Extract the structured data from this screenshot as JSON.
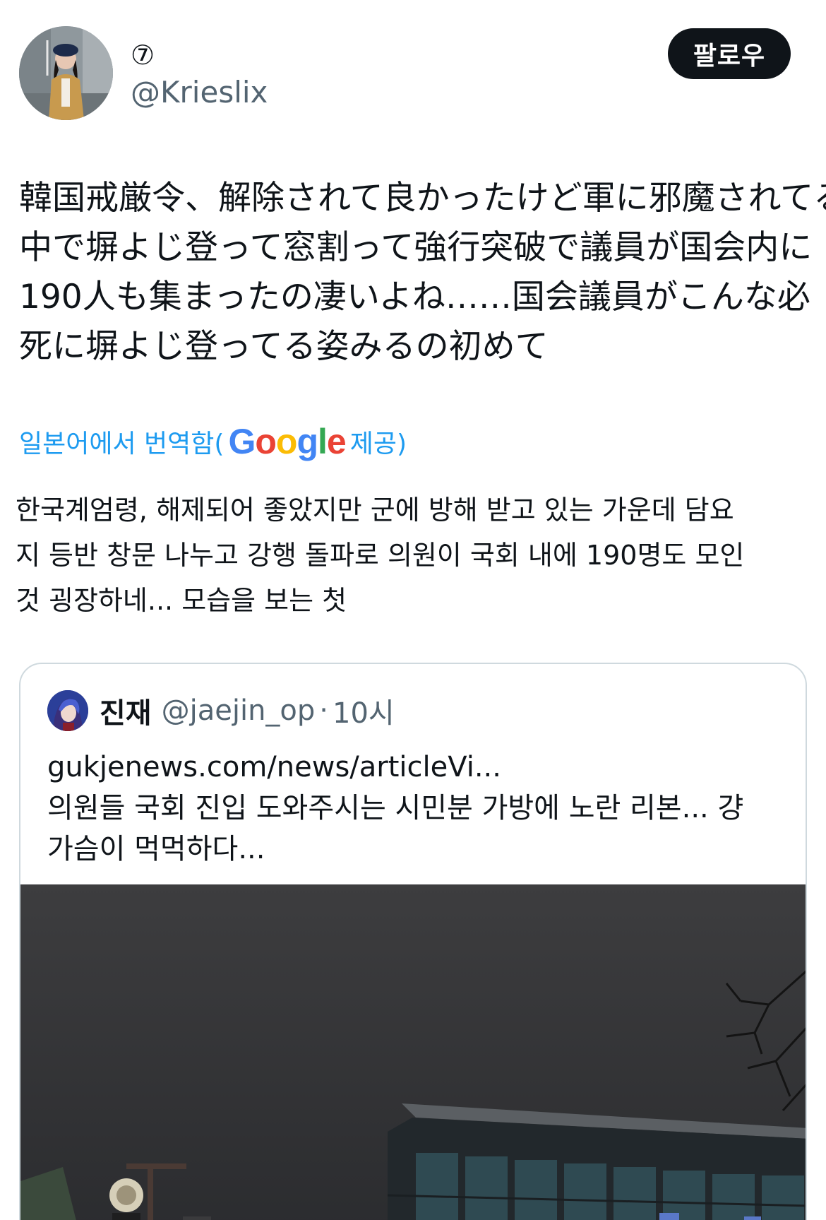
{
  "author": {
    "display_name": "⑦",
    "handle": "@Krieslix"
  },
  "follow_button_label": "팔로우",
  "tweet": {
    "lines": [
      "韓国戒厳令、解除されて良かったけど軍に邪魔されてる",
      "中で塀よじ登って窓割って強行突破で議員が国会内に",
      "190人も集まったの凄いよね……国会議員がこんな必",
      "死に塀よじ登ってる姿みるの初めて"
    ]
  },
  "translation": {
    "prefix": "일본어에서 번역함(",
    "google_letters": [
      "G",
      "o",
      "o",
      "g",
      "l",
      "e"
    ],
    "suffix": " 제공)",
    "lines": [
      "한국계엄령, 해제되어 좋았지만 군에 방해 받고 있는 가운데 담요",
      "지 등반 창문 나누고 강행 돌파로 의원이 국회 내에 190명도 모인",
      "것 굉장하네... 모습을 보는 첫"
    ]
  },
  "quote": {
    "name": "진재",
    "handle": "@jaejin_op",
    "separator": "·",
    "time": "10시",
    "lines": [
      "gukjenews.com/news/articleVi...",
      "의원들 국회 진입 도와주시는 시민분 가방에 노란 리본... 걍",
      "가슴이 먹먹하다..."
    ]
  },
  "colors": {
    "link_blue": "#1d9bf0",
    "text_primary": "#0f1419",
    "text_secondary": "#536471",
    "google_blue": "#4285f4",
    "google_red": "#ea4335",
    "google_yellow": "#fbbc05",
    "google_green": "#34a853"
  }
}
